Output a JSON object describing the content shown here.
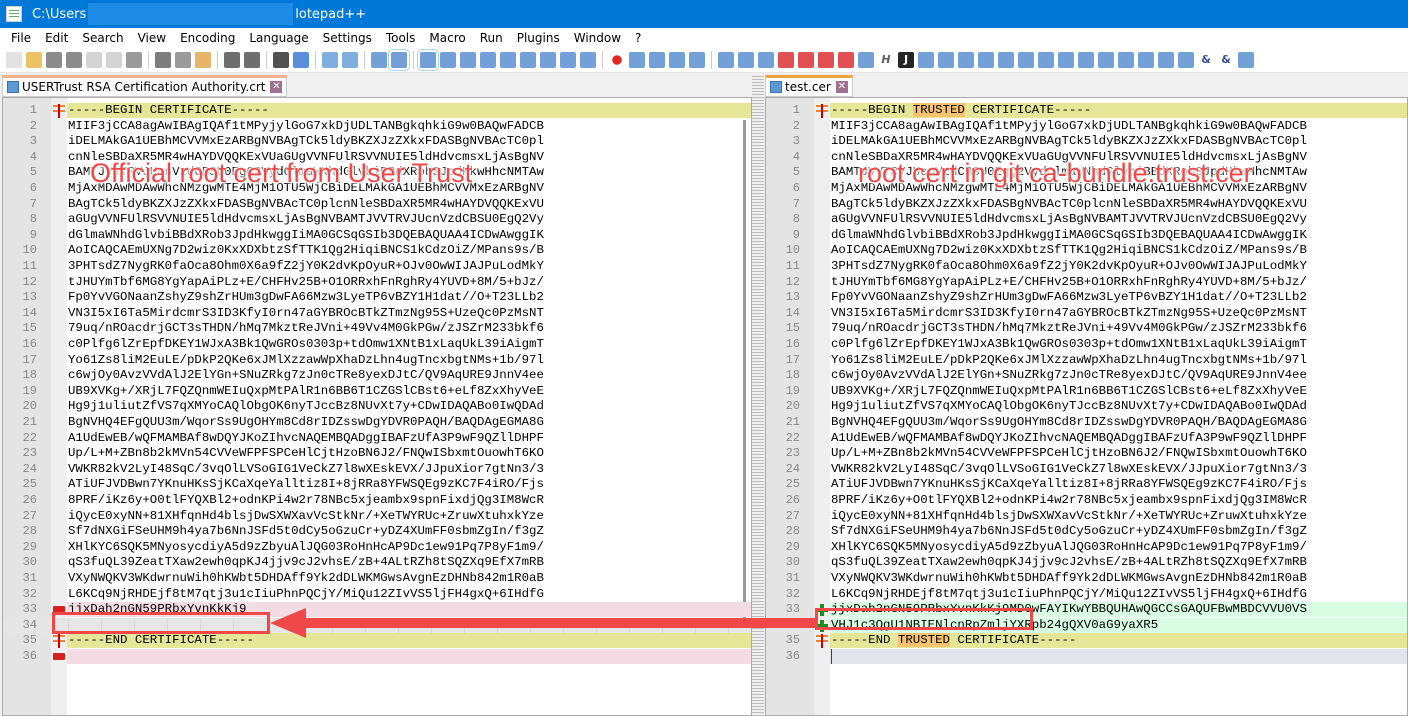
{
  "window": {
    "title_prefix": "C:\\Users",
    "title_suffix": "lotepad++"
  },
  "menu": [
    "File",
    "Edit",
    "Search",
    "View",
    "Encoding",
    "Language",
    "Settings",
    "Tools",
    "Macro",
    "Run",
    "Plugins",
    "Window",
    "?"
  ],
  "toolbar_icons": [
    "new-file",
    "open-file",
    "save",
    "save-all",
    "close",
    "close-all",
    "print",
    "|",
    "cut",
    "copy",
    "paste",
    "|",
    "undo",
    "redo",
    "|",
    "find",
    "replace",
    "|",
    "zoom-in",
    "zoom-out",
    "|",
    "sync-vertical",
    "sync-horizontal",
    "|",
    "word-wrap",
    "show-all-chars",
    "indent-guide",
    "user-lang",
    "doc-map",
    "doc-list",
    "function-list",
    "folder-workspace",
    "monitoring",
    "|",
    "record-macro",
    "stop-macro",
    "play-macro",
    "run-macro-multiple",
    "save-macro",
    "|",
    "compare",
    "clear-compare",
    "clear-all-compare",
    "first-diff",
    "prev-diff",
    "next-diff",
    "last-diff",
    "compare-options",
    "heading",
    "json",
    "xml",
    "validate",
    "first-change",
    "prev-change",
    "next-change",
    "last-change",
    "next-file",
    "prev-file",
    "next-file-alt",
    "pilcrow-off",
    "doc",
    "doc-diff",
    "doc-search",
    "doc-run",
    "ampersand",
    "ampersand-off",
    "back"
  ],
  "left": {
    "tab_label": "USERTrust RSA Certification Authority.crt",
    "lines": [
      "-----BEGIN CERTIFICATE-----",
      "MIIF3jCCA8agAwIBAgIQAf1tMPyjylGoG7xkDjUDLTANBgkqhkiG9w0BAQwFADCB",
      "iDELMAkGA1UEBhMCVVMxEzARBgNVBAgTCk5ldyBKZXJzZXkxFDASBgNVBAcTC0pl",
      "cnNleSBDaXR5MR4wHAYDVQQKExVUaGUgVVNFUlRSVVNUIE5ldHdvcmsxLjAsBgNV",
      "BAMTJVVTRVJUcnVzdCBSU0EgQ2VydGlmaWNhdGlvbiBBdXRob3JpdHkwHhcNMTAw",
      "MjAxMDAwMDAwWhcNMzgwMTE4MjM1OTU5WjCBiDELMAkGA1UEBhMCVVMxEzARBgNV",
      "BAgTCk5ldyBKZXJzZXkxFDASBgNVBAcTC0plcnNleSBDaXR5MR4wHAYDVQQKExVU",
      "aGUgVVNFUlRSVVNUIE5ldHdvcmsxLjAsBgNVBAMTJVVTRVJUcnVzdCBSU0EgQ2Vy",
      "dGlmaWNhdGlvbiBBdXRob3JpdHkwggIiMA0GCSqGSIb3DQEBAQUAA4ICDwAwggIK",
      "AoICAQCAEmUXNg7D2wiz0KxXDXbtzSfTTK1Qg2HiqiBNCS1kCdzOiZ/MPans9s/B",
      "3PHTsdZ7NygRK0faOca8Ohm0X6a9fZ2jY0K2dvKpOyuR+OJv0OwWIJAJPuLodMkY",
      "tJHUYmTbf6MG8YgYapAiPLz+E/CHFHv25B+O1ORRxhFnRghRy4YUVD+8M/5+bJz/",
      "Fp0YvVGONaanZshyZ9shZrHUm3gDwFA66Mzw3LyeTP6vBZY1H1dat//O+T23LLb2",
      "VN3I5xI6Ta5MirdcmrS3ID3KfyI0rn47aGYBROcBTkZTmzNg95S+UzeQc0PzMsNT",
      "79uq/nROacdrjGCT3sTHDN/hMq7MkztReJVni+49Vv4M0GkPGw/zJSZrM233bkf6",
      "c0Plfg6lZrEpfDKEY1WJxA3Bk1QwGROs0303p+tdOmw1XNtB1xLaqUkL39iAigmT",
      "Yo61Zs8liM2EuLE/pDkP2QKe6xJMlXzzawWpXhaDzLhn4ugTncxbgtNMs+1b/97l",
      "c6wjOy0AvzVVdAlJ2ElYGn+SNuZRkg7zJn0cTRe8yexDJtC/QV9AqURE9JnnV4ee",
      "UB9XVKg+/XRjL7FQZQnmWEIuQxpMtPAlR1n6BB6T1CZGSlCBst6+eLf8ZxXhyVeE",
      "Hg9j1uliutZfVS7qXMYoCAQlObgOK6nyTJccBz8NUvXt7y+CDwIDAQABo0IwQDAd",
      "BgNVHQ4EFgQUU3m/WqorSs9UgOHYm8Cd8rIDZsswDgYDVR0PAQH/BAQDAgEGMA8G",
      "A1UdEwEB/wQFMAMBAf8wDQYJKoZIhvcNAQEMBQADggIBAFzUfA3P9wF9QZllDHPF",
      "Up/L+M+ZBn8b2kMVn54CVVeWFPFSPCeHlCjtHzoBN6J2/FNQwISbxmtOuowhT6KO",
      "VWKR82kV2LyI48SqC/3vqOlLVSoGIG1VeCkZ7l8wXEskEVX/JJpuXior7gtNn3/3",
      "ATiUFJVDBwn7YKnuHKsSjKCaXqeYalltiz8I+8jRRa8YFWSQEg9zKC7F4iRO/Fjs",
      "8PRF/iKz6y+O0tlFYQXBl2+odnKPi4w2r78NBc5xjeambx9spnFixdjQg3IM8WcR",
      "iQycE0xyNN+81XHfqnHd4blsjDwSXWXavVcStkNr/+XeTWYRUc+ZruwXtuhxkYze",
      "Sf7dNXGiFSeUHM9h4ya7b6NnJSFd5t0dCy5oGzuCr+yDZ4XUmFF0sbmZgIn/f3gZ",
      "XHlKYC6SQK5MNyosycdiyA5d9zZbyuAlJQG03RoHnHcAP9Dc1ew91Pq7P8yF1m9/",
      "qS3fuQL39ZeatTXaw2ewh0qpKJ4jjv9cJ2vhsE/zB+4ALtRZh8tSQZXq9EfX7mRB",
      "VXyNWQKV3WKdwrnuWih0hKWbt5DHDAff9Yk2dDLWKMGwsAvgnEzDHNb842m1R0aB",
      "L6KCq9NjRHDEjf8tM7qtj3u1cIiuPhnPQCjY/MiQu12ZIvVS5ljFH4gxQ+6IHdfG",
      "jjxDah2nGN59PRbxYvnKkKj9",
      "",
      "-----END CERTIFICATE-----",
      ""
    ]
  },
  "right": {
    "tab_label": "test.cer",
    "lines": [
      "-----BEGIN TRUSTED CERTIFICATE-----",
      "MIIF3jCCA8agAwIBAgIQAf1tMPyjylGoG7xkDjUDLTANBgkqhkiG9w0BAQwFADCB",
      "iDELMAkGA1UEBhMCVVMxEzARBgNVBAgTCk5ldyBKZXJzZXkxFDASBgNVBAcTC0pl",
      "cnNleSBDaXR5MR4wHAYDVQQKExVUaGUgVVNFUlRSVVNUIE5ldHdvcmsxLjAsBgNV",
      "BAMTJVVTRVJUcnVzdCBSU0EgQ2VydGlmaWNhdGlvbiBBdXRob3JpdHkwHhcNMTAw",
      "MjAxMDAwMDAwWhcNMzgwMTE4MjM1OTU5WjCBiDELMAkGA1UEBhMCVVMxEzARBgNV",
      "BAgTCk5ldyBKZXJzZXkxFDASBgNVBAcTC0plcnNleSBDaXR5MR4wHAYDVQQKExVU",
      "aGUgVVNFUlRSVVNUIE5ldHdvcmsxLjAsBgNVBAMTJVVTRVJUcnVzdCBSU0EgQ2Vy",
      "dGlmaWNhdGlvbiBBdXRob3JpdHkwggIiMA0GCSqGSIb3DQEBAQUAA4ICDwAwggIK",
      "AoICAQCAEmUXNg7D2wiz0KxXDXbtzSfTTK1Qg2HiqiBNCS1kCdzOiZ/MPans9s/B",
      "3PHTsdZ7NygRK0faOca8Ohm0X6a9fZ2jY0K2dvKpOyuR+OJv0OwWIJAJPuLodMkY",
      "tJHUYmTbf6MG8YgYapAiPLz+E/CHFHv25B+O1ORRxhFnRghRy4YUVD+8M/5+bJz/",
      "Fp0YvVGONaanZshyZ9shZrHUm3gDwFA66Mzw3LyeTP6vBZY1H1dat//O+T23LLb2",
      "VN3I5xI6Ta5MirdcmrS3ID3KfyI0rn47aGYBROcBTkZTmzNg95S+UzeQc0PzMsNT",
      "79uq/nROacdrjGCT3sTHDN/hMq7MkztReJVni+49Vv4M0GkPGw/zJSZrM233bkf6",
      "c0Plfg6lZrEpfDKEY1WJxA3Bk1QwGROs0303p+tdOmw1XNtB1xLaqUkL39iAigmT",
      "Yo61Zs8liM2EuLE/pDkP2QKe6xJMlXzzawWpXhaDzLhn4ugTncxbgtNMs+1b/97l",
      "c6wjOy0AvzVVdAlJ2ElYGn+SNuZRkg7zJn0cTRe8yexDJtC/QV9AqURE9JnnV4ee",
      "UB9XVKg+/XRjL7FQZQnmWEIuQxpMtPAlR1n6BB6T1CZGSlCBst6+eLf8ZxXhyVeE",
      "Hg9j1uliutZfVS7qXMYoCAQlObgOK6nyTJccBz8NUvXt7y+CDwIDAQABo0IwQDAd",
      "BgNVHQ4EFgQUU3m/WqorSs9UgOHYm8Cd8rIDZsswDgYDVR0PAQH/BAQDAgEGMA8G",
      "A1UdEwEB/wQFMAMBAf8wDQYJKoZIhvcNAQEMBQADggIBAFzUfA3P9wF9QZllDHPF",
      "Up/L+M+ZBn8b2kMVn54CVVeWFPFSPCeHlCjtHzoBN6J2/FNQwISbxmtOuowhT6KO",
      "VWKR82kV2LyI48SqC/3vqOlLVSoGIG1VeCkZ7l8wXEskEVX/JJpuXior7gtNn3/3",
      "ATiUFJVDBwn7YKnuHKsSjKCaXqeYalltiz8I+8jRRa8YFWSQEg9zKC7F4iRO/Fjs",
      "8PRF/iKz6y+O0tlFYQXBl2+odnKPi4w2r78NBc5xjeambx9spnFixdjQg3IM8WcR",
      "iQycE0xyNN+81XHfqnHd4blsjDwSXWXavVcStkNr/+XeTWYRUc+ZruwXtuhxkYze",
      "Sf7dNXGiFSeUHM9h4ya7b6NnJSFd5t0dCy5oGzuCr+yDZ4XUmFF0sbmZgIn/f3gZ",
      "XHlKYC6SQK5MNyosycdiyA5d9zZbyuAlJQG03RoHnHcAP9Dc1ew91Pq7P8yF1m9/",
      "qS3fuQL39ZeatTXaw2ewh0qpKJ4jjv9cJ2vhsE/zB+4ALtRZh8tSQZXq9EfX7mRB",
      "VXyNWQKV3WKdwrnuWih0hKWbt5DHDAff9Yk2dDLWKMGwsAvgnEzDHNb842m1R0aB",
      "L6KCq9NjRHDEjf8tM7qtj3u1cIiuPhnPQCjY/MiQu12ZIvVS5ljFH4gxQ+6IHdfG",
      "jjxDah2nGN59PRbxYvnKkKj9MD0wFAYIKwYBBQUHAwQGCCsGAQUFBwMBDCVVU0VS",
      "VHJ1c3QgU1NBIENlcnRpZmljYXRpb24gQXV0aG9yaXR5",
      "-----END TRUSTED CERTIFICATE-----",
      ""
    ],
    "highlight_word": "TRUSTED"
  },
  "annotations": {
    "left_label": "Official root cert from User Trust",
    "right_label": "root cert in git ca-bundle.trust.cer",
    "color": "#f04848"
  },
  "diff_colors": {
    "changed": "#e6e698",
    "removed": "#f4dce4",
    "added": "#d9fde3",
    "added_overlay": "#28f0a0"
  }
}
